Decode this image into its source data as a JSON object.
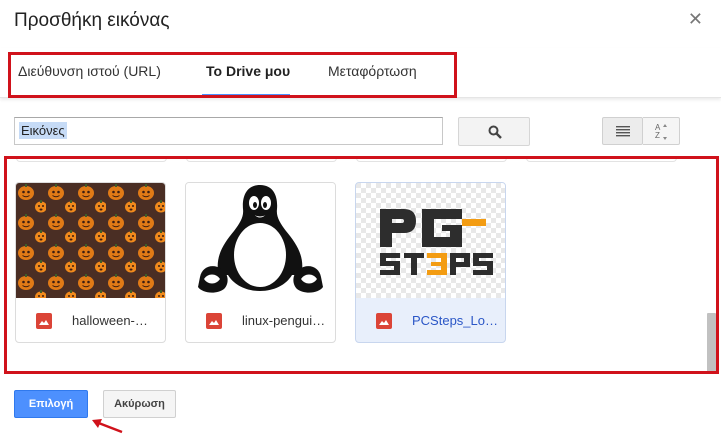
{
  "dialog": {
    "title": "Προσθήκη εικόνας",
    "close_icon": "close-icon"
  },
  "tabs": [
    {
      "label": "Διεύθυνση ιστού (URL)",
      "active": false
    },
    {
      "label": "Το Drive μου",
      "active": true
    },
    {
      "label": "Μεταφόρτωση",
      "active": false
    }
  ],
  "search": {
    "value": "Εικόνες",
    "button_icon": "search-icon"
  },
  "view_controls": {
    "list_view_icon": "list-view-icon",
    "sort_icon": "sort-az-icon"
  },
  "files": [
    {
      "name": "halloween-…",
      "type_icon": "image-file-icon",
      "selected": false,
      "thumb": "pumpkin-pattern"
    },
    {
      "name": "linux-pengui…",
      "type_icon": "image-file-icon",
      "selected": false,
      "thumb": "tux-penguin"
    },
    {
      "name": "PCSteps_Lo…",
      "type_icon": "image-file-icon",
      "selected": true,
      "thumb": "pcsteps-logo"
    }
  ],
  "actions": {
    "select_label": "Επιλογή",
    "cancel_label": "Ακύρωση"
  },
  "colors": {
    "accent": "#4d90fe",
    "annotation_red": "#d0121b",
    "file_icon_red": "#db4437",
    "logo_orange": "#f39c12"
  }
}
